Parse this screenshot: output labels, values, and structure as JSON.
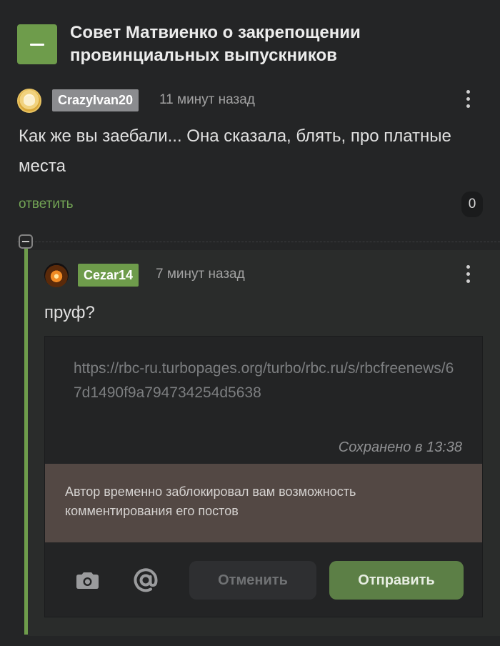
{
  "post": {
    "title": "Совет Матвиенко о закрепощении провинциальных выпускников"
  },
  "comment1": {
    "username": "CrazyIvan20",
    "time": "11 минут назад",
    "text": "Как же вы заебали... Она сказала, блять, про платные места",
    "reply_label": "ответить",
    "rating": "0"
  },
  "comment2": {
    "username": "Cezar14",
    "time": "7 минут назад",
    "text": "пруф?"
  },
  "editor": {
    "link": "https://rbc-ru.turbopages.org/turbo/rbc.ru/s/rbcfreenews/67d1490f9a794734254d5638",
    "saved": "Сохранено в 13:38",
    "blocked_message": "Автор временно заблокировал вам возможность комментирования его постов",
    "cancel_label": "Отменить",
    "send_label": "Отправить"
  },
  "colors": {
    "accent_green": "#6e9c4b",
    "background": "#242526",
    "blocked_bg": "#534844"
  },
  "icons": {
    "collapse": "minus-icon",
    "more": "more-vertical-icon",
    "camera": "camera-icon",
    "mention": "at-icon"
  }
}
